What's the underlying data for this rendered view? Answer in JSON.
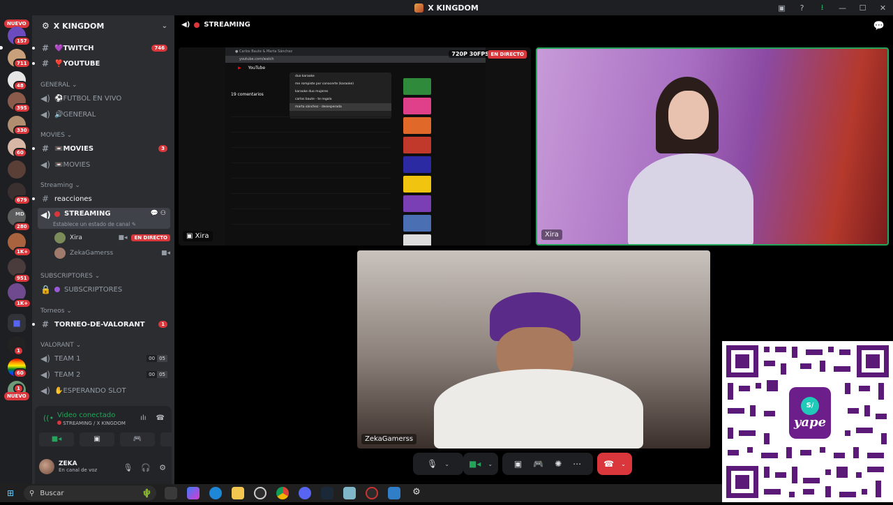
{
  "app": {
    "title": "X KINGDOM"
  },
  "rail": {
    "top_badge": "NUEVO",
    "bottom_badge": "NUEVO",
    "badges": [
      "157",
      "711",
      "48",
      "395",
      "330",
      "60",
      "679",
      "MD",
      "280",
      "1K+",
      "951",
      "1K+",
      "1",
      "60",
      "1"
    ]
  },
  "guild": {
    "name": "X KINGDOM"
  },
  "channels": {
    "twitch": {
      "name": "💜TWITCH",
      "badge": "746"
    },
    "youtube": {
      "name": "❣️YOUTUBE"
    },
    "cat_general": "GENERAL",
    "futbol": "⚽FUTBOL EN VIVO",
    "general": "🔊GENERAL",
    "cat_movies": "MOVIES",
    "movies_text": {
      "name": "📼MOVIES",
      "badge": "3"
    },
    "movies_voice": "📼MOVIES",
    "cat_streaming": "Streaming",
    "reacciones": "reacciones",
    "streaming": "STREAMING",
    "status_hint": "Establece un estado de canal",
    "voice_users": [
      {
        "name": "Xira",
        "live": "EN DIRECTO"
      },
      {
        "name": "ZekaGamerss"
      }
    ],
    "cat_subs": "SUBSCRIPTORES",
    "subs": "SUBSCRIPTORES",
    "cat_torneos": "Torneos",
    "torneo": {
      "name": "TORNEO-DE-VALORANT",
      "badge": "1"
    },
    "cat_valorant": "VALORANT",
    "team1": {
      "name": "TEAM 1",
      "a": "00",
      "b": "05"
    },
    "team2": {
      "name": "TEAM 2",
      "a": "00",
      "b": "05"
    },
    "esperando": "✋ESPERANDO SLOT"
  },
  "voice_panel": {
    "title": "Video conectado",
    "subtitle": "STREAMING / X KINGDOM",
    "user": "ZEKA",
    "user_status": "En canal de voz"
  },
  "stage": {
    "channel": "STREAMING",
    "screen_label": "Xira",
    "resolution": "720P 30FPS",
    "live": "EN DIRECTO",
    "xira_label": "Xira",
    "zeka_label": "ZekaGamerss"
  },
  "yt_dropdown": [
    "duo karaoke",
    "me rompiste por conocerte (karaoke)",
    "karaoke duo mujeres",
    "carlos baute - te regalo",
    "marta sánchez - desesperada"
  ],
  "yt_comments_header": "19 comentarios",
  "qr": {
    "brand": "yape",
    "mark": "S/"
  },
  "taskbar": {
    "search_placeholder": "Buscar"
  },
  "colors": {
    "accent": "#5865f2",
    "live": "#da373c",
    "connected": "#23a55a"
  }
}
